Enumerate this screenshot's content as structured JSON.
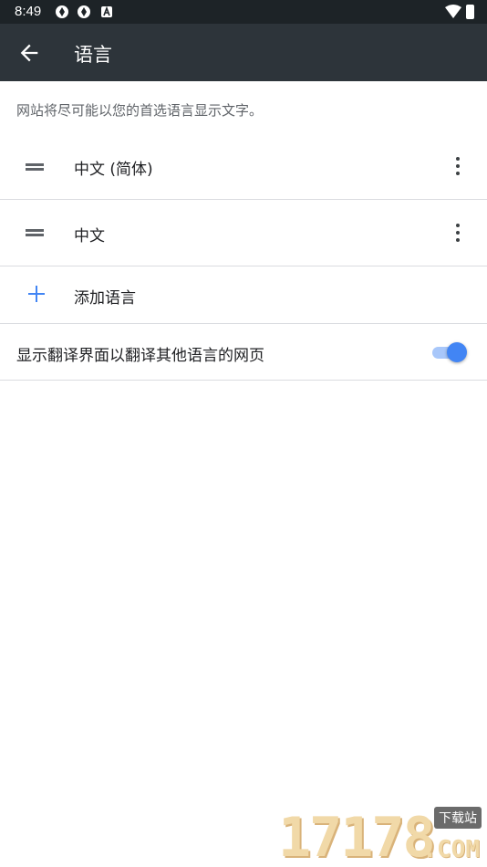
{
  "status_bar": {
    "time": "8:49",
    "icons": [
      "shutter-icon",
      "shutter-icon",
      "a-badge-icon",
      "wifi-icon",
      "battery-charging-icon"
    ]
  },
  "toolbar": {
    "back_icon": "arrow-back-icon",
    "title": "语言"
  },
  "description": "网站将尽可能以您的首选语言显示文字。",
  "languages": [
    {
      "label": "中文 (简体)",
      "handle_icon": "drag-handle-icon",
      "menu_icon": "more-vert-icon"
    },
    {
      "label": "中文",
      "handle_icon": "drag-handle-icon",
      "menu_icon": "more-vert-icon"
    }
  ],
  "add_language": {
    "icon": "plus-icon",
    "label": "添加语言"
  },
  "translate_toggle": {
    "label": "显示翻译界面以翻译其他语言的网页",
    "enabled": true
  },
  "watermark": {
    "digits": "17178",
    "badge": "下载站",
    "suffix": ".COM"
  },
  "colors": {
    "toolbar": "#2d343a",
    "status_bar": "#1d2327",
    "accent": "#4285f4",
    "divider": "#dadce0"
  }
}
